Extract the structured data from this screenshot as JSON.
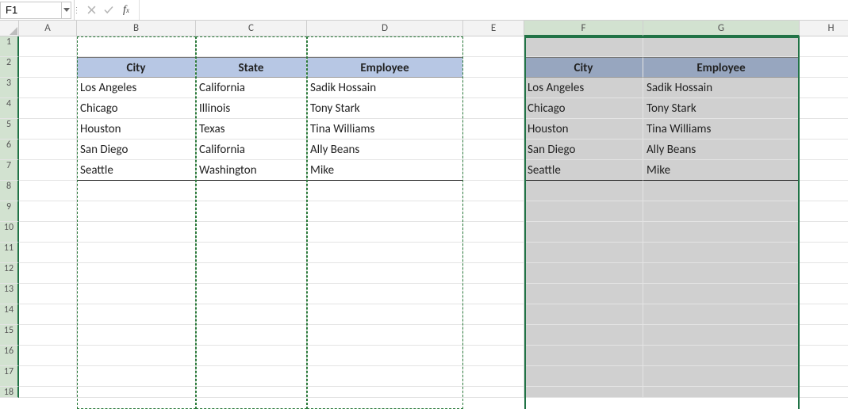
{
  "namebox": "F1",
  "formula": "",
  "columns": [
    "A",
    "B",
    "C",
    "D",
    "E",
    "F",
    "G",
    "H"
  ],
  "row_count": 18,
  "chart_data": {
    "type": "table",
    "title": "",
    "tables": [
      {
        "range": "B2:D7",
        "headers": [
          "City",
          "State",
          "Employee"
        ],
        "rows": [
          [
            "Los Angeles",
            "California",
            "Sadik Hossain"
          ],
          [
            "Chicago",
            "Illinois",
            "Tony Stark"
          ],
          [
            "Houston",
            "Texas",
            "Tina Williams"
          ],
          [
            "San Diego",
            "California",
            "Ally Beans"
          ],
          [
            "Seattle",
            "Washington",
            "Mike"
          ]
        ]
      },
      {
        "range": "F2:G7",
        "headers": [
          "City",
          "Employee"
        ],
        "rows": [
          [
            "Los Angeles",
            "Sadik Hossain"
          ],
          [
            "Chicago",
            "Tony Stark"
          ],
          [
            "Houston",
            "Tina Williams"
          ],
          [
            "San Diego",
            "Ally Beans"
          ],
          [
            "Seattle",
            "Mike"
          ]
        ]
      }
    ]
  },
  "t1": {
    "h": {
      "city": "City",
      "state": "State",
      "emp": "Employee"
    },
    "r": [
      {
        "city": "Los Angeles",
        "state": "California",
        "emp": "Sadik Hossain"
      },
      {
        "city": "Chicago",
        "state": "Illinois",
        "emp": "Tony Stark"
      },
      {
        "city": "Houston",
        "state": "Texas",
        "emp": "Tina Williams"
      },
      {
        "city": "San Diego",
        "state": "California",
        "emp": "Ally Beans"
      },
      {
        "city": "Seattle",
        "state": "Washington",
        "emp": "Mike"
      }
    ]
  },
  "t2": {
    "h": {
      "city": "City",
      "emp": "Employee"
    },
    "r": [
      {
        "city": "Los Angeles",
        "emp": "Sadik Hossain"
      },
      {
        "city": "Chicago",
        "emp": "Tony Stark"
      },
      {
        "city": "Houston",
        "emp": "Tina Williams"
      },
      {
        "city": "San Diego",
        "emp": "Ally Beans"
      },
      {
        "city": "Seattle",
        "emp": "Mike"
      }
    ]
  }
}
